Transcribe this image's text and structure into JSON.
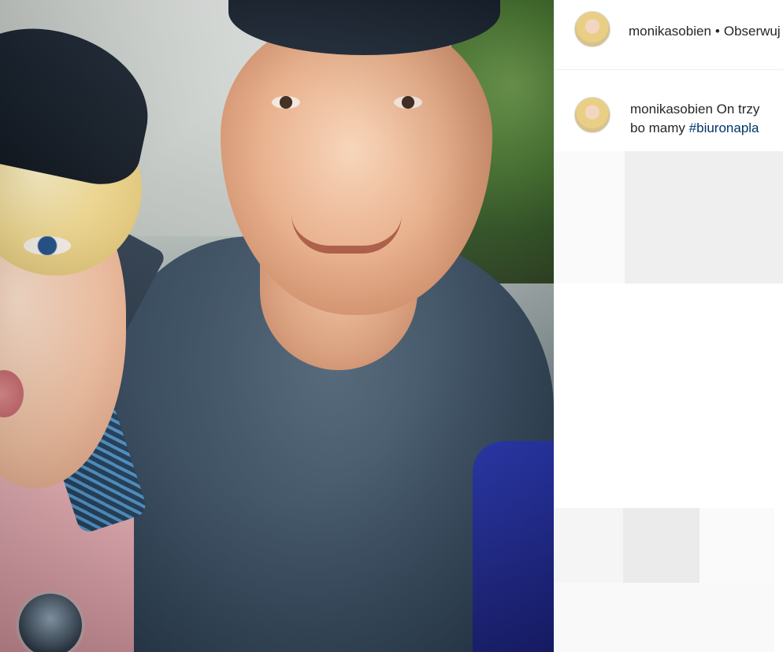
{
  "post": {
    "username": "monikasobien",
    "separator": "•",
    "follow_label": "Obserwuj",
    "caption": {
      "username": "monikasobien",
      "text_line1": "On trzy",
      "text_line2": "bo mamy",
      "hashtag": "#biuronapla"
    }
  },
  "colors": {
    "text": "#262626",
    "hashtag": "#003569",
    "divider": "#efefef",
    "placeholder": "#efefef"
  },
  "icons": {
    "avatar": "profile-avatar"
  }
}
